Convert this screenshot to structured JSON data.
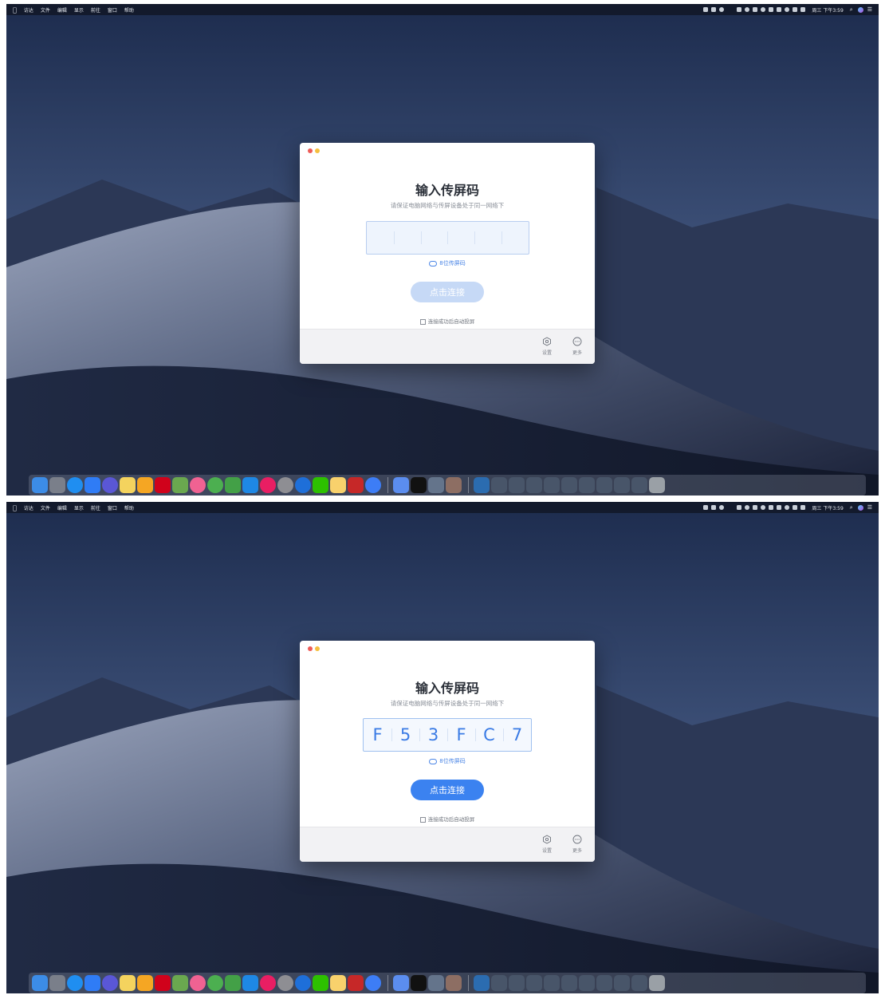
{
  "menubar": {
    "apple": "",
    "items": [
      "访达",
      "文件",
      "编辑",
      "显示",
      "前往",
      "窗口",
      "帮助"
    ],
    "clock": "周三 下午3:59"
  },
  "dialog": {
    "title": "输入传屏码",
    "subtitle": "请保证电脑网络与传屏设备处于同一网络下",
    "code_hint": "8位传屏码",
    "connect_label": "点击连接",
    "auto_cast_label": "连接成功后自动投屏",
    "settings_label": "设置",
    "more_label": "更多"
  },
  "states": [
    {
      "code_value": "",
      "connect_enabled": false
    },
    {
      "code_value": "F53FC7",
      "connect_enabled": true
    }
  ],
  "colors": {
    "accent": "#3b82f0",
    "accent_disabled": "#c6d9f6",
    "code_text": "#3a7be5",
    "close": "#ee5b57",
    "minimize": "#f5bf3f"
  },
  "dock_apps": [
    "finder-icon",
    "launchpad-icon",
    "safari-icon",
    "app-store-icon",
    "siri-icon",
    "notes-icon",
    "sketch-icon",
    "youdao-icon",
    "preview-icon",
    "photos-icon",
    "chrome-icon",
    "numbers-icon",
    "keynote-icon",
    "music-icon",
    "system-preferences-icon",
    "browser-icon",
    "wechat-icon",
    "screenshot-icon",
    "acrobat-icon",
    "ticktick-icon",
    "screen-share-icon",
    "qq-icon",
    "image-capture-icon",
    "books-icon",
    "folder-icon",
    "window-1-icon",
    "window-2-icon",
    "window-3-icon",
    "window-4-icon",
    "window-5-icon",
    "window-6-icon",
    "window-7-icon",
    "window-8-icon",
    "window-9-icon",
    "trash-icon"
  ]
}
